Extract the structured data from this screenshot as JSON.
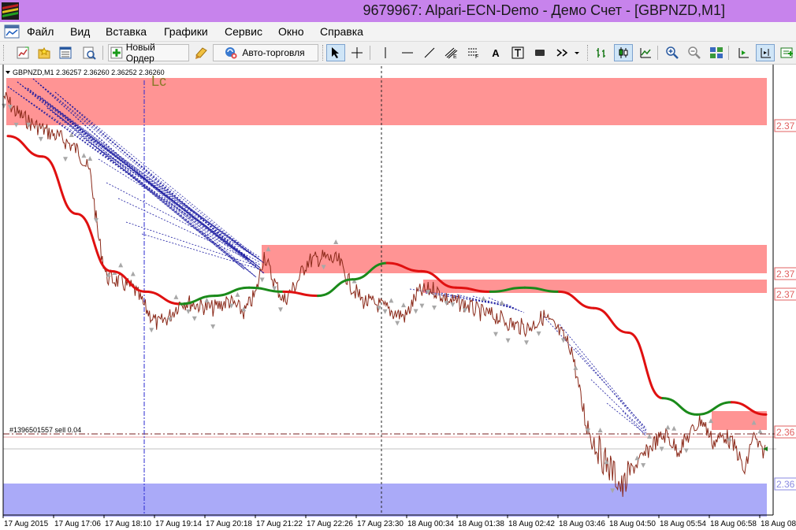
{
  "window": {
    "title": "9679967: Alpari-ECN-Demo - Демо Счет - [GBPNZD,M1]"
  },
  "menu": {
    "items": [
      "Файл",
      "Вид",
      "Вставка",
      "Графики",
      "Сервис",
      "Окно",
      "Справка"
    ]
  },
  "toolbar": {
    "new_order_label": "Новый Ордер",
    "auto_trading_label": "Авто-торговля",
    "text_tool_label": "A"
  },
  "chart": {
    "symbol_info": "GBPNZD,M1  2.36257 2.36260 2.36252 2.36260",
    "lc_label": "Lc",
    "order_label": "#1396501557 sell 0.04",
    "price_labels": [
      "2.37",
      "2.37",
      "2.37",
      "2.36",
      "2.36"
    ],
    "time_labels": [
      "17 Aug 2015",
      "17 Aug 17:06",
      "17 Aug 18:10",
      "17 Aug 19:14",
      "17 Aug 20:18",
      "17 Aug 21:22",
      "17 Aug 22:26",
      "17 Aug 23:30",
      "18 Aug 00:34",
      "18 Aug 01:38",
      "18 Aug 02:42",
      "18 Aug 03:46",
      "18 Aug 04:50",
      "18 Aug 05:54",
      "18 Aug 06:58",
      "18 Aug 08:"
    ],
    "colors": {
      "price_line": "#8b2a1a",
      "ma_down": "#e01010",
      "ma_up": "#1a8a1a",
      "zone_resistance": "#ff9494",
      "zone_support": "#aaaaf8",
      "fan_lines": "#1a1aa0",
      "fractal_arrows": "#a8a8a8"
    },
    "ma_trend": [
      [
        "down",
        2.3731
      ],
      [
        "down",
        2.3726
      ],
      [
        "down",
        2.3712
      ],
      [
        "down",
        2.3698
      ],
      [
        "down",
        2.3693
      ],
      [
        "down",
        2.369
      ],
      [
        "up",
        2.3692
      ],
      [
        "up",
        2.3694
      ],
      [
        "up",
        2.3693
      ],
      [
        "down",
        2.3692
      ],
      [
        "up",
        2.3696
      ],
      [
        "up",
        2.37
      ],
      [
        "down",
        2.3698
      ],
      [
        "down",
        2.3694
      ],
      [
        "down",
        2.3693
      ],
      [
        "up",
        2.3694
      ],
      [
        "up",
        2.3693
      ],
      [
        "down",
        2.3689
      ],
      [
        "down",
        2.3683
      ],
      [
        "down",
        2.3667
      ],
      [
        "up",
        2.3663
      ],
      [
        "up",
        2.3666
      ],
      [
        "down",
        2.3663
      ]
    ]
  }
}
